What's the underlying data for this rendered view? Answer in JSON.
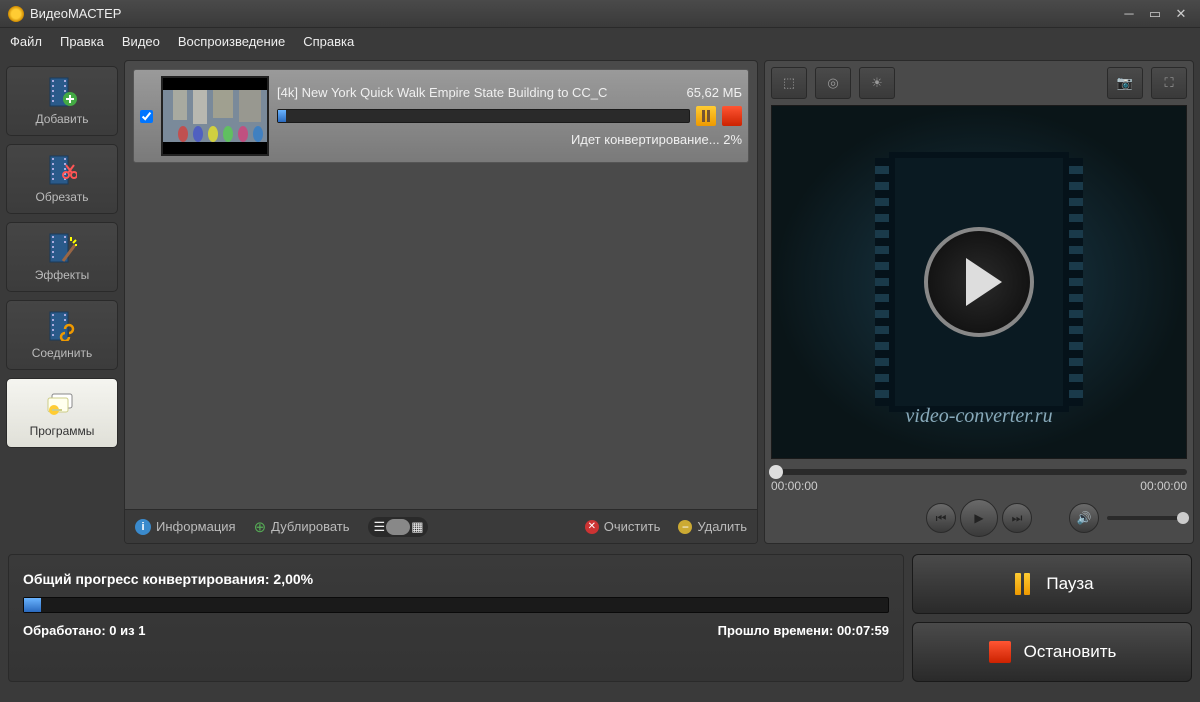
{
  "window": {
    "title": "ВидеоМАСТЕР"
  },
  "menu": {
    "file": "Файл",
    "edit": "Правка",
    "video": "Видео",
    "playback": "Воспроизведение",
    "help": "Справка"
  },
  "sidebar": {
    "add": "Добавить",
    "trim": "Обрезать",
    "effects": "Эффекты",
    "join": "Соединить",
    "programs": "Программы"
  },
  "file": {
    "name": "[4k] New York Quick Walk Empire State Building to CC_C",
    "size": "65,62 МБ",
    "status": "Идет конвертирование... 2%"
  },
  "centerFooter": {
    "info": "Информация",
    "duplicate": "Дублировать",
    "clear": "Очистить",
    "delete": "Удалить"
  },
  "preview": {
    "brand": "video-converter.ru",
    "timeStart": "00:00:00",
    "timeEnd": "00:00:00"
  },
  "progress": {
    "title": "Общий прогресс конвертирования: 2,00%",
    "processed": "Обработано: 0 из 1",
    "elapsed": "Прошло времени: 00:07:59"
  },
  "controls": {
    "pause": "Пауза",
    "stop": "Остановить"
  }
}
